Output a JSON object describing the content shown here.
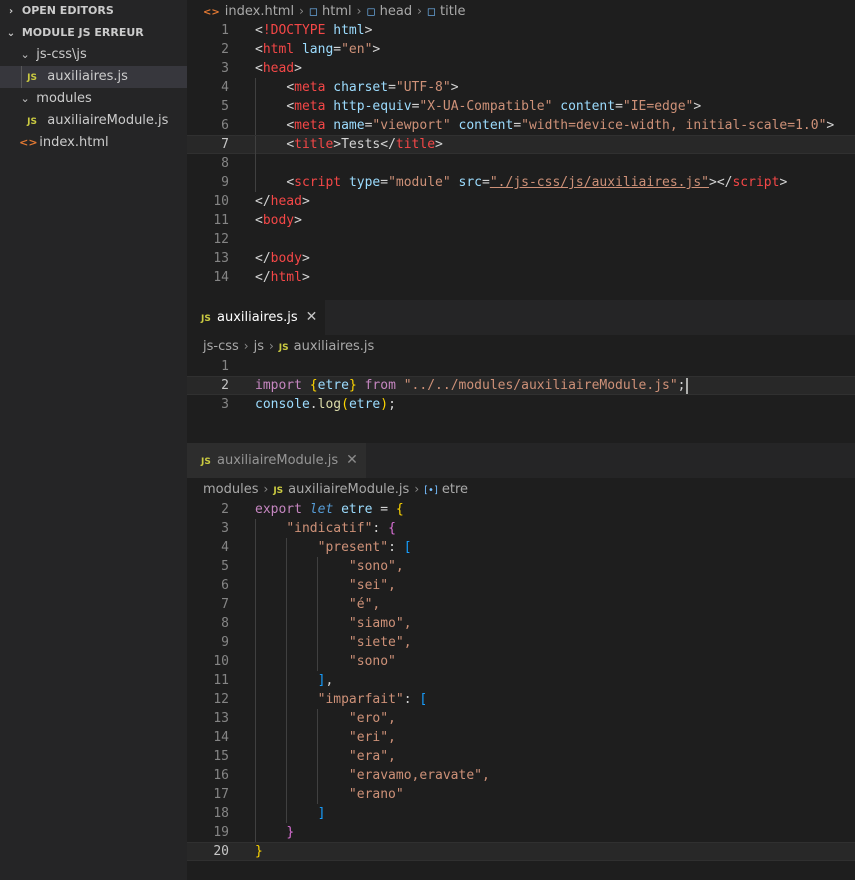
{
  "sidebar": {
    "open_editors": "OPEN EDITORS",
    "project": "MODULE JS ERREUR",
    "tree": {
      "folder_jscss": "js-css\\js",
      "file_aux": "auxiliaires.js",
      "folder_modules": "modules",
      "file_auxmod": "auxiliaireModule.js",
      "file_index": "index.html"
    },
    "js_badge": "JS",
    "html_badge": "<>"
  },
  "editor1": {
    "breadcrumb": [
      "index.html",
      "html",
      "head",
      "title"
    ],
    "line_numbers": [
      "1",
      "2",
      "3",
      "4",
      "5",
      "6",
      "7",
      "8",
      "9",
      "10",
      "11",
      "12",
      "13",
      "14"
    ]
  },
  "editor2": {
    "tab_label": "auxiliaires.js",
    "breadcrumb": [
      "js-css",
      "js",
      "auxiliaires.js"
    ],
    "line_numbers": [
      "1",
      "2",
      "3"
    ]
  },
  "editor3": {
    "tab_label": "auxiliaireModule.js",
    "breadcrumb": [
      "modules",
      "auxiliaireModule.js",
      "etre"
    ],
    "line_numbers": [
      "2",
      "3",
      "4",
      "5",
      "6",
      "7",
      "8",
      "9",
      "10",
      "11",
      "12",
      "13",
      "14",
      "15",
      "16",
      "17",
      "18",
      "19",
      "20"
    ]
  },
  "code": {
    "doctype": "<!DOCTYPE html>",
    "html_open": "<html lang=\"en\">",
    "lang_val": "\"en\"",
    "charset_val": "\"UTF-8\"",
    "equiv_val": "\"X-UA-Compatible\"",
    "equiv_content": "\"IE=edge\"",
    "viewport_name": "\"viewport\"",
    "viewport_content": "\"width=device-width, initial-scale=1.0\"",
    "title_text": "Tests",
    "script_type": "\"module\"",
    "script_src": "\"./js-css/js/auxiliaires.js\"",
    "import_path": "\"../../modules/auxiliaireModule.js\"",
    "import_name": "etre",
    "console": "console",
    "log": "log",
    "etre": "etre",
    "indicatif": "\"indicatif\"",
    "present": "\"present\"",
    "present_items": [
      "\"sono\",",
      "\"sei\",",
      "\"é\",",
      "\"siamo\",",
      "\"siete\",",
      "\"sono\""
    ],
    "imparfait": "\"imparfait\"",
    "imparfait_items": [
      "\"ero\",",
      "\"eri\",",
      "\"era\",",
      "\"eravamo,eravate\",",
      "\"erano\""
    ]
  },
  "colors": {
    "editor_bg": "#1e1e1e",
    "sidebar_bg": "#252526",
    "tag": "#f44747",
    "string": "#ce9178",
    "keyword": "#c586c0"
  }
}
